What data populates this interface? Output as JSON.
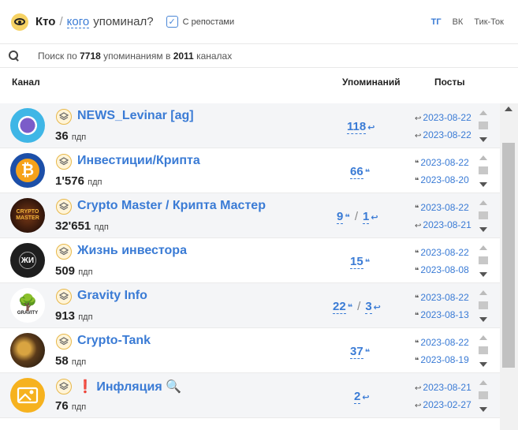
{
  "header": {
    "who": "Кто",
    "sep": "/",
    "whom": "кого",
    "rest": "упоминал?",
    "checkbox_mark": "✓",
    "checkbox_label": "С репостами",
    "platforms": [
      "ТГ",
      "ВК",
      "Тик-Ток"
    ]
  },
  "search": {
    "pre": "Поиск по ",
    "count": "7718",
    "mid": " упоминаниям в ",
    "channels": "2011",
    "post": " каналах"
  },
  "columns": {
    "channel": "Канал",
    "mentions": "Упоминаний",
    "posts": "Посты"
  },
  "unit": "пдп",
  "rows": [
    {
      "name": "NEWS_Levinar [ag]",
      "subs": "36",
      "m1": "118",
      "m1_icon": "repost-icon",
      "m2": "",
      "d1": "2023-08-22",
      "d2": "2023-08-22",
      "d1_icon": "repost-icon",
      "d2_icon": "repost-icon"
    },
    {
      "name": "Инвестиции/Крипта",
      "subs": "1'576",
      "m1": "66",
      "m1_icon": "quote-icon",
      "m2": "",
      "d1": "2023-08-22",
      "d2": "2023-08-20",
      "d1_icon": "quote-icon",
      "d2_icon": "quote-icon"
    },
    {
      "name": "Crypto Master / Крипта Мастер",
      "subs": "32'651",
      "m1": "9",
      "m1_icon": "quote-icon",
      "m2": "1",
      "d1": "2023-08-22",
      "d2": "2023-08-21",
      "d1_icon": "quote-icon",
      "d2_icon": "repost-icon"
    },
    {
      "name": "Жизнь инвестора",
      "subs": "509",
      "m1": "15",
      "m1_icon": "quote-icon",
      "m2": "",
      "d1": "2023-08-22",
      "d2": "2023-08-08",
      "d1_icon": "quote-icon",
      "d2_icon": "quote-icon"
    },
    {
      "name": "Gravity Info",
      "subs": "913",
      "m1": "22",
      "m1_icon": "quote-icon",
      "m2": "3",
      "d1": "2023-08-22",
      "d2": "2023-08-13",
      "d1_icon": "quote-icon",
      "d2_icon": "quote-icon"
    },
    {
      "name": "Crypto-Tank",
      "subs": "58",
      "m1": "37",
      "m1_icon": "quote-icon",
      "m2": "",
      "d1": "2023-08-22",
      "d2": "2023-08-19",
      "d1_icon": "quote-icon",
      "d2_icon": "quote-icon"
    },
    {
      "name": "Инфляция",
      "prefix": "❗",
      "suffix_icon": "magnifier-icon",
      "subs": "76",
      "m1": "2",
      "m1_icon": "repost-icon",
      "m2": "",
      "d1": "2023-08-21",
      "d2": "2023-02-27",
      "d1_icon": "repost-icon",
      "d2_icon": "repost-icon"
    }
  ],
  "avatars": {
    "row2_text": "₿",
    "row3_text": "CRYPTO MASTER",
    "row4_text": "ЖИ",
    "row5_text": "GRAVITY"
  },
  "colors": {
    "accent": "#3a7bd5",
    "gold": "#f6d264",
    "rowAlt": "#f4f5f7"
  }
}
